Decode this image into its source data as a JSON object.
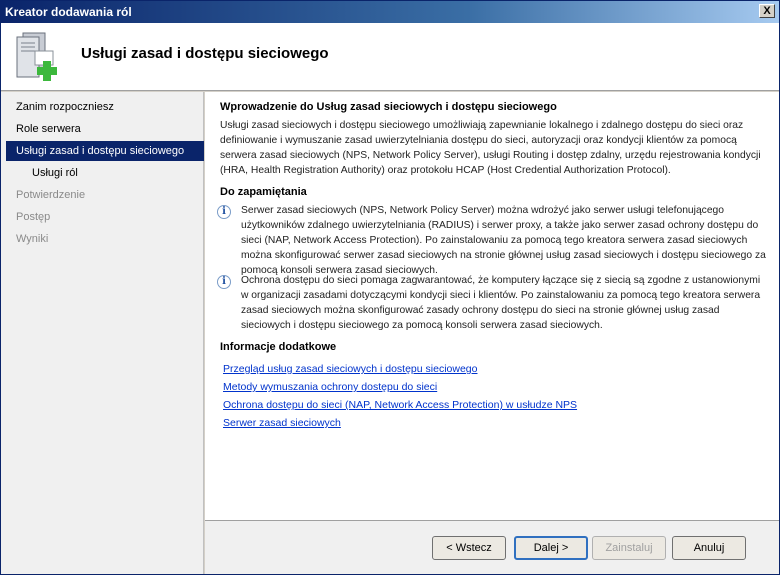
{
  "window": {
    "title": "Kreator dodawania ról",
    "close_label": "X"
  },
  "header": {
    "title": "Usługi zasad i dostępu sieciowego",
    "icon": "server-add-icon"
  },
  "sidebar": {
    "items": [
      {
        "label": "Zanim rozpoczniesz",
        "state": "normal"
      },
      {
        "label": "Role serwera",
        "state": "normal"
      },
      {
        "label": "Usługi zasad i dostępu sieciowego",
        "state": "active"
      },
      {
        "label": "Usługi ról",
        "state": "sub"
      },
      {
        "label": "Potwierdzenie",
        "state": "disabled"
      },
      {
        "label": "Postęp",
        "state": "disabled"
      },
      {
        "label": "Wyniki",
        "state": "disabled"
      }
    ]
  },
  "main": {
    "intro_heading": "Wprowadzenie do Usług zasad sieciowych i dostępu sieciowego",
    "intro_text": "Usługi zasad sieciowych i dostępu sieciowego umożliwiają zapewnianie lokalnego i zdalnego dostępu do sieci oraz definiowanie i wymuszanie zasad uwierzytelniania dostępu do sieci, autoryzacji oraz kondycji klientów za pomocą serwera zasad sieciowych (NPS, Network Policy Server), usługi Routing i dostęp zdalny, urzędu rejestrowania kondycji (HRA, Health Registration Authority) oraz protokołu HCAP (Host Credential Authorization Protocol).",
    "notes_heading": "Do zapamiętania",
    "notes": [
      "Serwer zasad sieciowych (NPS, Network Policy Server) można wdrożyć jako serwer usługi telefonującego użytkowników zdalnego uwierzytelniania (RADIUS) i serwer proxy, a także jako serwer zasad ochrony dostępu do sieci (NAP, Network Access Protection). Po zainstalowaniu za pomocą tego kreatora serwera zasad sieciowych można skonfigurować serwer zasad sieciowych na stronie głównej usług zasad sieciowych i dostępu sieciowego za pomocą konsoli serwera zasad sieciowych.",
      "Ochrona dostępu do sieci pomaga zagwarantować, że komputery łączące się z siecią są zgodne z ustanowionymi w organizacji zasadami dotyczącymi kondycji sieci i klientów. Po zainstalowaniu za pomocą tego kreatora serwera zasad sieciowych można skonfigurować zasady ochrony dostępu do sieci na stronie głównej usług zasad sieciowych i dostępu sieciowego za pomocą konsoli serwera zasad sieciowych."
    ],
    "more_heading": "Informacje dodatkowe",
    "links": [
      "Przegląd usług zasad sieciowych i dostępu sieciowego",
      "Metody wymuszania ochrony dostępu do sieci",
      "Ochrona dostępu do sieci (NAP, Network Access Protection) w usłudze NPS",
      "Serwer zasad sieciowych"
    ]
  },
  "footer": {
    "back_label": "< Wstecz",
    "next_label": "Dalej >",
    "install_label": "Zainstaluj",
    "cancel_label": "Anuluj"
  }
}
